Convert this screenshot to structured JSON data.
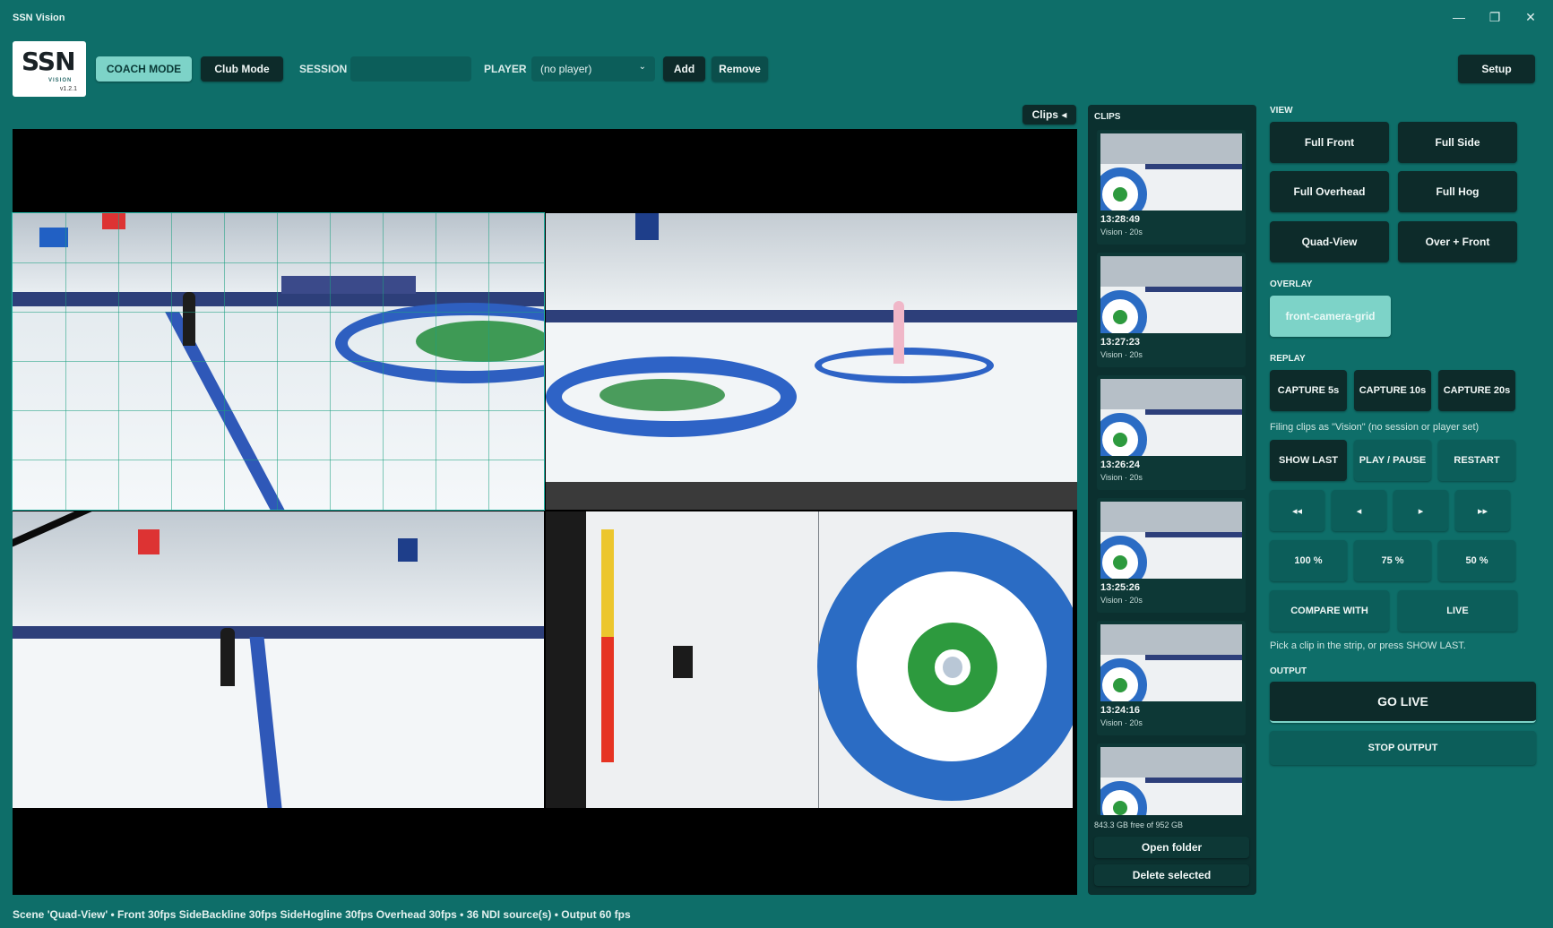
{
  "app": {
    "title": "SSN Vision"
  },
  "window": {
    "minimize": "—",
    "restore": "❐",
    "close": "✕"
  },
  "logo": {
    "main": "SSN",
    "sub": "VISION",
    "version": "v1.2.1"
  },
  "header": {
    "coach_mode": "COACH MODE",
    "club_mode": "Club Mode",
    "session_label": "SESSION",
    "session_value": "",
    "player_label": "PLAYER",
    "player_selected": "(no player)",
    "add": "Add",
    "remove": "Remove",
    "setup": "Setup"
  },
  "video": {
    "clips_toggle": "Clips ◂"
  },
  "clips": {
    "title": "CLIPS",
    "items": [
      {
        "time": "13:28:49",
        "meta": "Vision · 20s"
      },
      {
        "time": "13:27:23",
        "meta": "Vision · 20s"
      },
      {
        "time": "13:26:24",
        "meta": "Vision · 20s"
      },
      {
        "time": "13:25:26",
        "meta": "Vision · 20s"
      },
      {
        "time": "13:24:16",
        "meta": "Vision · 20s"
      },
      {
        "time": "",
        "meta": ""
      }
    ],
    "storage": "843.3 GB free of 952 GB",
    "open_folder": "Open folder",
    "delete_selected": "Delete selected"
  },
  "view": {
    "title": "VIEW",
    "full_front": "Full Front",
    "full_side": "Full Side",
    "full_overhead": "Full Overhead",
    "full_hog": "Full Hog",
    "quad_view": "Quad-View",
    "over_front": "Over + Front"
  },
  "overlay": {
    "title": "OVERLAY",
    "front_camera_grid": "front-camera-grid"
  },
  "replay": {
    "title": "REPLAY",
    "capture_5": "CAPTURE 5s",
    "capture_10": "CAPTURE 10s",
    "capture_20": "CAPTURE 20s",
    "filing_hint": "Filing clips as \"Vision\"  (no session or player set)",
    "show_last": "SHOW LAST",
    "play_pause": "PLAY / PAUSE",
    "restart": "RESTART",
    "rewind": "◂◂",
    "step_back": "◂",
    "step_forward": "▸",
    "fast_forward": "▸▸",
    "speed_100": "100 %",
    "speed_75": "75 %",
    "speed_50": "50 %",
    "compare_with": "COMPARE WITH",
    "live": "LIVE",
    "pick_hint": "Pick a clip in the strip, or press SHOW LAST."
  },
  "output": {
    "title": "OUTPUT",
    "go_live": "GO LIVE",
    "stop_output": "STOP OUTPUT"
  },
  "status": {
    "text": "Scene 'Quad-View'  •  Front 30fps  SideBackline 30fps  SideHogline 30fps  Overhead 30fps  •  36 NDI source(s)  •  Output 60 fps"
  },
  "colors": {
    "background": "#0e6e69",
    "button": "#0d2b2a",
    "accent": "#7dd3c8"
  }
}
